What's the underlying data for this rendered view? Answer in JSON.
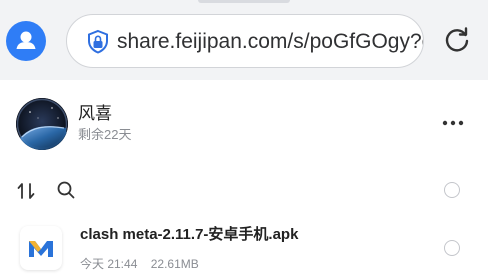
{
  "browser": {
    "url": "share.feijipan.com/s/poGfGOgy?c",
    "icons": {
      "account": "account-icon",
      "lock": "shield-lock-icon",
      "reload": "reload-icon"
    },
    "colors": {
      "account_bg": "#2f7df6",
      "toolbar_bg": "#f2f3f5"
    }
  },
  "share": {
    "owner_name": "风喜",
    "remaining": "剩余22天",
    "more_icon": "more-dots-icon"
  },
  "toolbar": {
    "icons": {
      "sort": "sort-icon",
      "search": "search-icon",
      "select_all": "radio-icon"
    }
  },
  "files": [
    {
      "name": "clash meta-2.11.7-安卓手机.apk",
      "time": "今天 21:44",
      "size": "22.61MB",
      "icon": "app-m-icon"
    }
  ]
}
